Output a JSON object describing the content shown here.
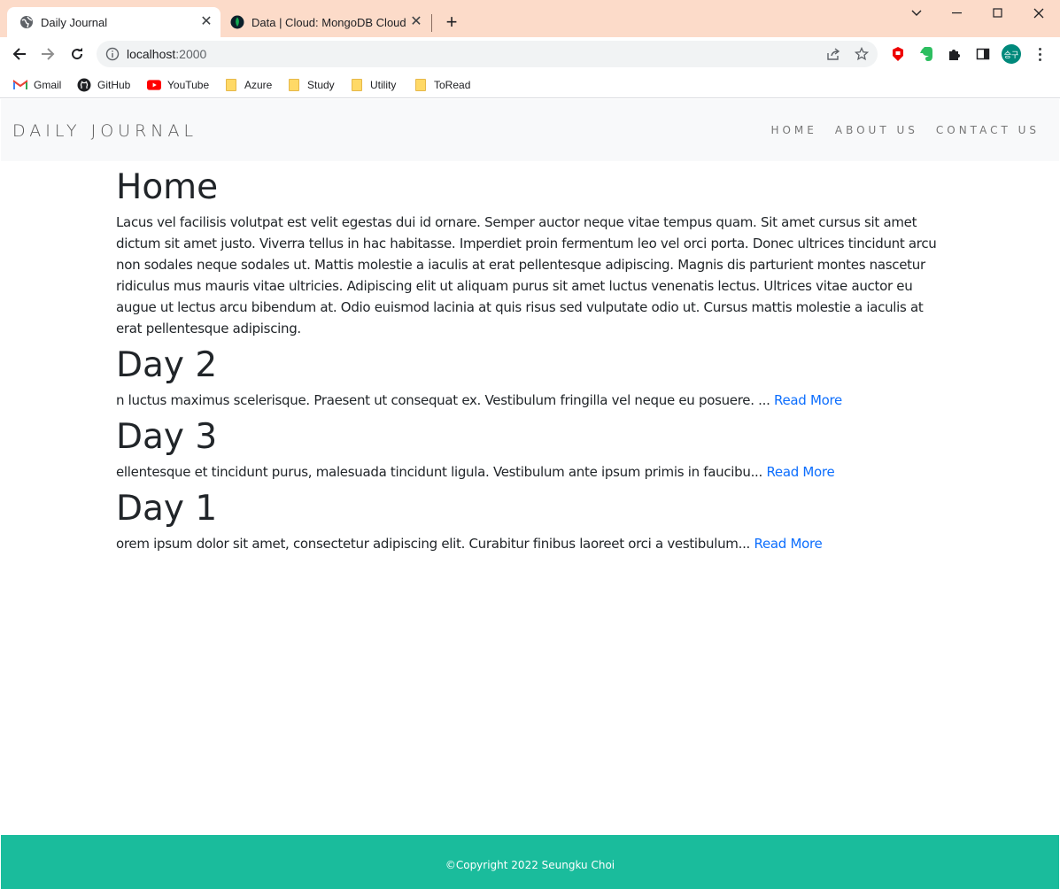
{
  "browser": {
    "tabs": [
      {
        "title": "Daily Journal",
        "icon": "globe-icon",
        "active": true
      },
      {
        "title": "Data | Cloud: MongoDB Cloud",
        "icon": "mongodb-leaf-icon",
        "active": false
      }
    ],
    "url_host": "localhost",
    "url_port": ":2000",
    "bookmarks": [
      {
        "label": "Gmail",
        "icon": "gmail-icon"
      },
      {
        "label": "GitHub",
        "icon": "github-icon"
      },
      {
        "label": "YouTube",
        "icon": "youtube-icon"
      },
      {
        "label": "Azure",
        "icon": "folder-icon"
      },
      {
        "label": "Study",
        "icon": "folder-icon"
      },
      {
        "label": "Utility",
        "icon": "folder-icon"
      },
      {
        "label": "ToRead",
        "icon": "folder-icon"
      }
    ],
    "profile_initials": "승구",
    "colors": {
      "tabbar": "#fcdbc9",
      "accent_footer": "#1abc9c",
      "link": "#0d6efd"
    }
  },
  "site": {
    "brand": "DAILY JOURNAL",
    "nav": [
      "HOME",
      "ABOUT US",
      "CONTACT US"
    ]
  },
  "home": {
    "heading": "Home",
    "text": "Lacus vel facilisis volutpat est velit egestas dui id ornare. Semper auctor neque vitae tempus quam. Sit amet cursus sit amet dictum sit amet justo. Viverra tellus in hac habitasse. Imperdiet proin fermentum leo vel orci porta. Donec ultrices tincidunt arcu non sodales neque sodales ut. Mattis molestie a iaculis at erat pellentesque adipiscing. Magnis dis parturient montes nascetur ridiculus mus mauris vitae ultricies. Adipiscing elit ut aliquam purus sit amet luctus venenatis lectus. Ultrices vitae auctor eu augue ut lectus arcu bibendum at. Odio euismod lacinia at quis risus sed vulputate odio ut. Cursus mattis molestie a iaculis at erat pellentesque adipiscing."
  },
  "posts": [
    {
      "title": "Day 2",
      "excerpt": "n luctus maximus scelerisque. Praesent ut consequat ex. Vestibulum fringilla vel neque eu posuere. ...",
      "link": "Read More"
    },
    {
      "title": "Day 3",
      "excerpt": "ellentesque et tincidunt purus, malesuada tincidunt ligula. Vestibulum ante ipsum primis in faucibu...",
      "link": "Read More"
    },
    {
      "title": "Day 1",
      "excerpt": "orem ipsum dolor sit amet, consectetur adipiscing elit. Curabitur finibus laoreet orci a vestibulum...",
      "link": "Read More"
    }
  ],
  "footer": {
    "copyright": "©Copyright 2022 Seungku Choi"
  }
}
